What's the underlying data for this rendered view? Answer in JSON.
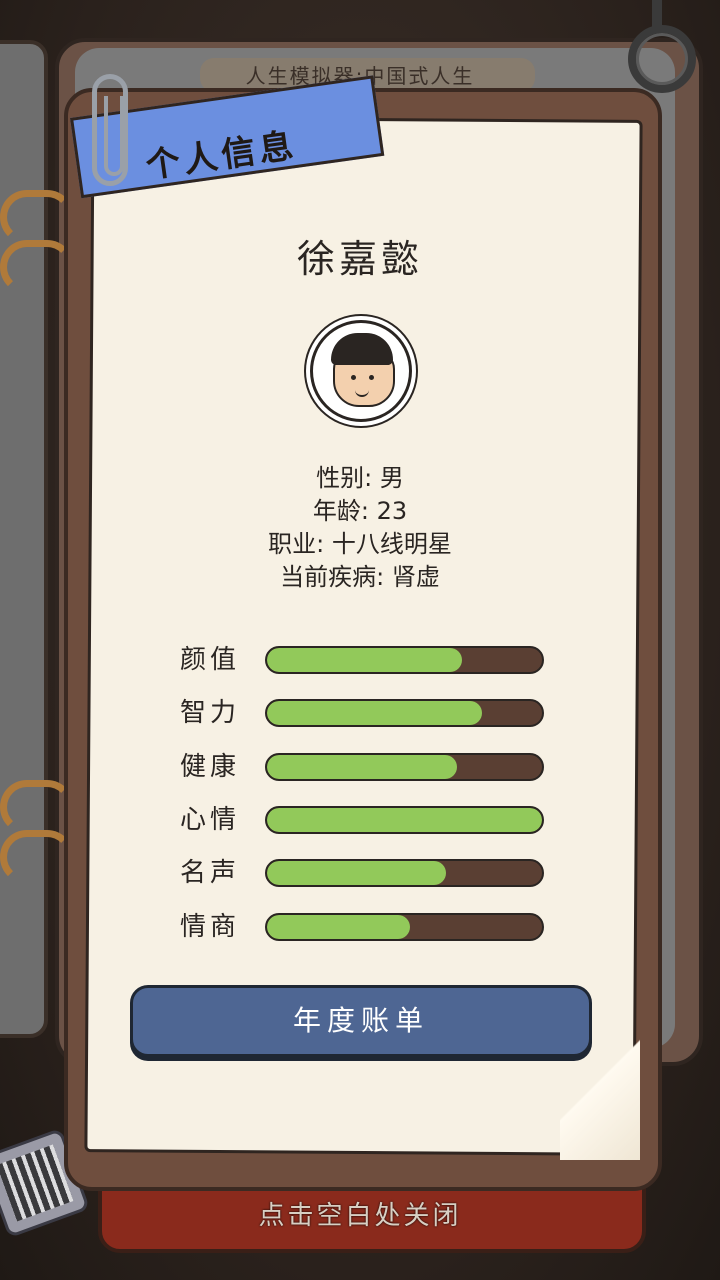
{
  "game_title": "人生模拟器:中国式人生",
  "panel": {
    "tab_label": "个人信息",
    "character_name": "徐嘉懿",
    "info": {
      "gender": "性别: 男",
      "age": "年龄: 23",
      "job": "职业: 十八线明星",
      "disease": "当前疾病: 肾虚"
    },
    "stats": [
      {
        "label": "颜值",
        "value": 0.71
      },
      {
        "label": "智力",
        "value": 0.78
      },
      {
        "label": "健康",
        "value": 0.69
      },
      {
        "label": "心情",
        "value": 1.0
      },
      {
        "label": "名声",
        "value": 0.65
      },
      {
        "label": "情商",
        "value": 0.52
      }
    ],
    "year_bill_button": "年度账单"
  },
  "close_hint": "点击空白处关闭",
  "colors": {
    "bar_fill": "#92c95a",
    "bar_track": "#5a3f33",
    "button": "#4e6693",
    "ribbon": "#6b8fe0"
  }
}
